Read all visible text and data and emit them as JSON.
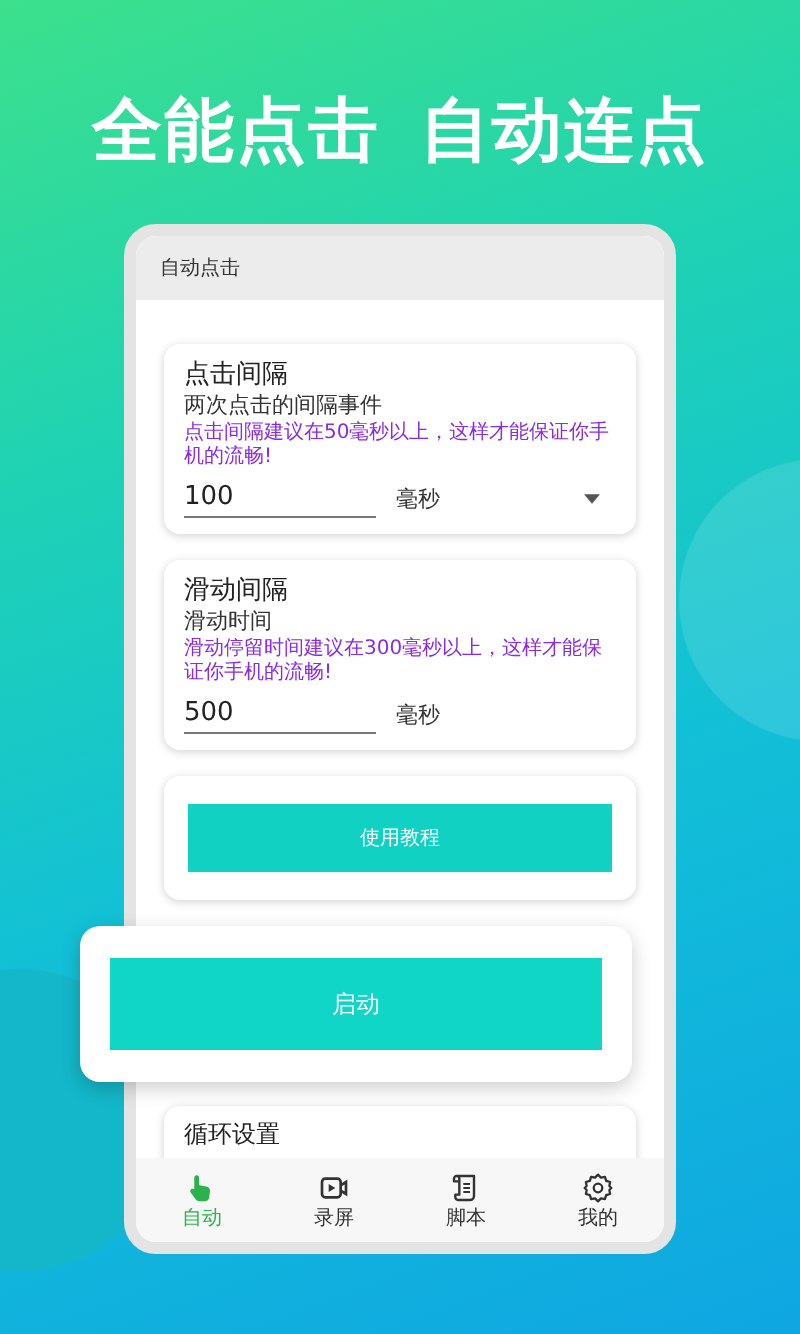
{
  "headline": [
    "全能点击",
    "自动连点"
  ],
  "app_bar": {
    "title": "自动点击"
  },
  "settings": [
    {
      "title": "点击间隔",
      "subtitle": "两次点击的间隔事件",
      "hint": "点击间隔建议在50毫秒以上，这样才能保证你手机的流畅!",
      "value": "100",
      "unit": "毫秒",
      "dropdown": true
    },
    {
      "title": "滑动间隔",
      "subtitle": "滑动时间",
      "hint": "滑动停留时间建议在300毫秒以上，这样才能保证你手机的流畅!",
      "value": "500",
      "unit": "毫秒",
      "dropdown": false
    }
  ],
  "tutorial_button": "使用教程",
  "start_button": "启动",
  "loop_section": {
    "title": "循环设置"
  },
  "nav": [
    {
      "label": "自动",
      "kind": "hand",
      "selected": true
    },
    {
      "label": "录屏",
      "kind": "video",
      "selected": false
    },
    {
      "label": "脚本",
      "kind": "script",
      "selected": false
    },
    {
      "label": "我的",
      "kind": "gear",
      "selected": false
    }
  ]
}
